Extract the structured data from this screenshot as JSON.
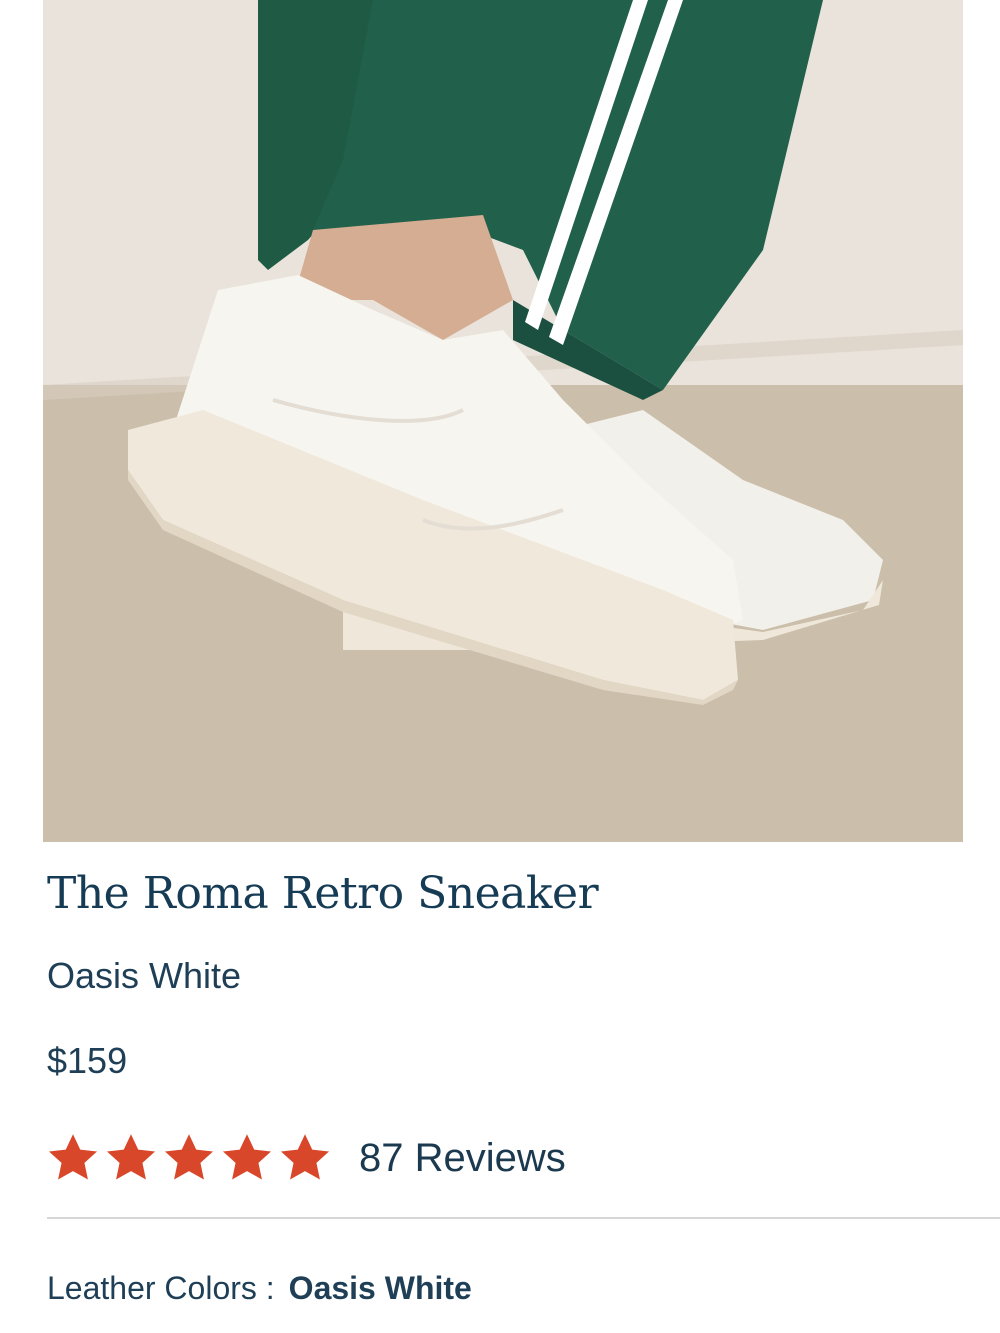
{
  "product": {
    "title": "The Roma Retro Sneaker",
    "color_name": "Oasis White",
    "price": "$159",
    "image_description": "white leather sneaker worn with green track pants"
  },
  "rating": {
    "stars": 5,
    "max_stars": 5,
    "reviews_label": "87 Reviews",
    "star_color": "#d9472b"
  },
  "leather_colors": {
    "label": "Leather Colors :",
    "selected": "Oasis White"
  },
  "colors": {
    "text": "#1c3a4f",
    "accent_star": "#d9472b",
    "divider": "#d6d6d6"
  }
}
